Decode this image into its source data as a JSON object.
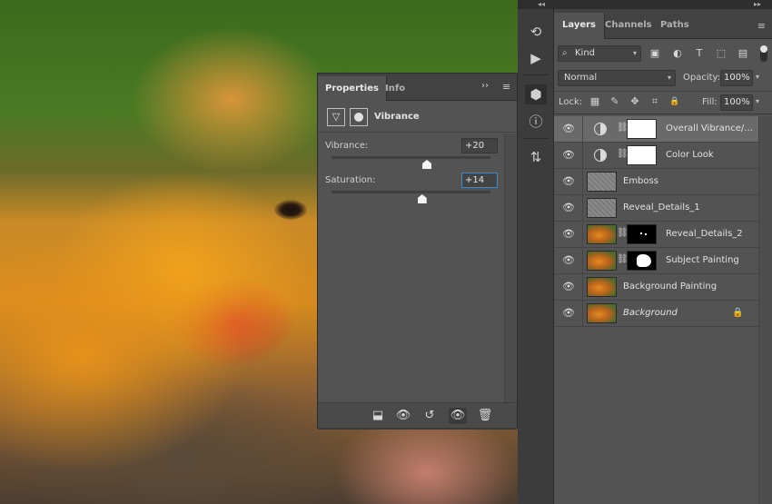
{
  "dock": {
    "collapse_arrows": "◂◂",
    "expand_arrows": "▸▸"
  },
  "tool_strip": {
    "items": [
      {
        "name": "history-icon",
        "glyph": "⟲"
      },
      {
        "name": "play-actions-icon",
        "glyph": "▶"
      },
      {
        "name": "3d-cube-icon",
        "glyph": "⬢"
      },
      {
        "name": "info-icon",
        "glyph": "ⓘ"
      },
      {
        "name": "clone-source-icon",
        "glyph": "⇅"
      }
    ]
  },
  "layers_panel": {
    "tabs": [
      "Layers",
      "Channels",
      "Paths"
    ],
    "menu_glyph": "≡",
    "filter": {
      "kind_label": "Kind",
      "search_glyph": "⌕",
      "caret": "▾"
    },
    "filter_icons": [
      {
        "name": "filter-pixel-icon",
        "glyph": "▣"
      },
      {
        "name": "filter-adjustment-icon",
        "glyph": "◐"
      },
      {
        "name": "filter-type-icon",
        "glyph": "T"
      },
      {
        "name": "filter-shape-icon",
        "glyph": "⬚"
      },
      {
        "name": "filter-smart-object-icon",
        "glyph": "▤"
      }
    ],
    "blend_mode": "Normal",
    "opacity_label": "Opacity:",
    "opacity_value": "100%",
    "lock_label": "Lock:",
    "lock_icons": [
      {
        "name": "lock-transparent-icon",
        "glyph": "▦"
      },
      {
        "name": "lock-pixels-icon",
        "glyph": "✎"
      },
      {
        "name": "lock-position-icon",
        "glyph": "✥"
      },
      {
        "name": "lock-artboard-icon",
        "glyph": "⌗"
      },
      {
        "name": "lock-all-icon",
        "glyph": "🔒"
      }
    ],
    "fill_label": "Fill:",
    "fill_value": "100%",
    "layers": [
      {
        "name": "Overall Vibrance/...",
        "type": "adjustment",
        "mask": "white",
        "selected": true
      },
      {
        "name": "Color Look",
        "type": "adjustment",
        "mask": "white",
        "selected": false
      },
      {
        "name": "Emboss",
        "type": "pixel",
        "thumb": "emboss",
        "selected": false
      },
      {
        "name": "Reveal_Details_1",
        "type": "pixel",
        "thumb": "emboss",
        "selected": false
      },
      {
        "name": "Reveal_Details_2",
        "type": "masked",
        "thumb": "fox",
        "mask": "dots",
        "selected": false
      },
      {
        "name": "Subject Painting",
        "type": "masked",
        "thumb": "fox",
        "mask": "shape",
        "selected": false
      },
      {
        "name": "Background Painting",
        "type": "pixel",
        "thumb": "fox",
        "selected": false
      },
      {
        "name": "Background",
        "type": "background",
        "thumb": "fox",
        "italic": true,
        "locked": true,
        "selected": false
      }
    ]
  },
  "properties_panel": {
    "tabs": [
      "Properties",
      "Info"
    ],
    "expand_glyph": "››",
    "menu_glyph": "≡",
    "title": "Vibrance",
    "adj_glyph": "▽",
    "sliders": [
      {
        "label": "Vibrance:",
        "value": "+20",
        "numeric": 20,
        "focused": false
      },
      {
        "label": "Saturation:",
        "value": "+14",
        "numeric": 14,
        "focused": true
      }
    ],
    "footer": [
      {
        "name": "clip-to-layer-icon",
        "glyph": "⬓",
        "active": false
      },
      {
        "name": "view-previous-state-icon",
        "glyph": "👁",
        "active": false
      },
      {
        "name": "reset-icon",
        "glyph": "↺",
        "active": false
      },
      {
        "name": "toggle-visibility-icon",
        "glyph": "👁",
        "active": true
      },
      {
        "name": "delete-icon",
        "glyph": "🗑",
        "active": false
      }
    ]
  }
}
